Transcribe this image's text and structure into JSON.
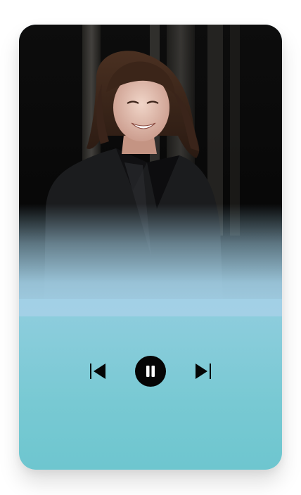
{
  "player": {
    "state": "playing",
    "controls": {
      "previous_icon": "skip-previous-icon",
      "play_pause_icon": "pause-icon",
      "next_icon": "skip-next-icon"
    },
    "colors": {
      "background_top": "#a3d0e6",
      "background_bottom": "#6ec6cf",
      "control": "#050505"
    }
  }
}
